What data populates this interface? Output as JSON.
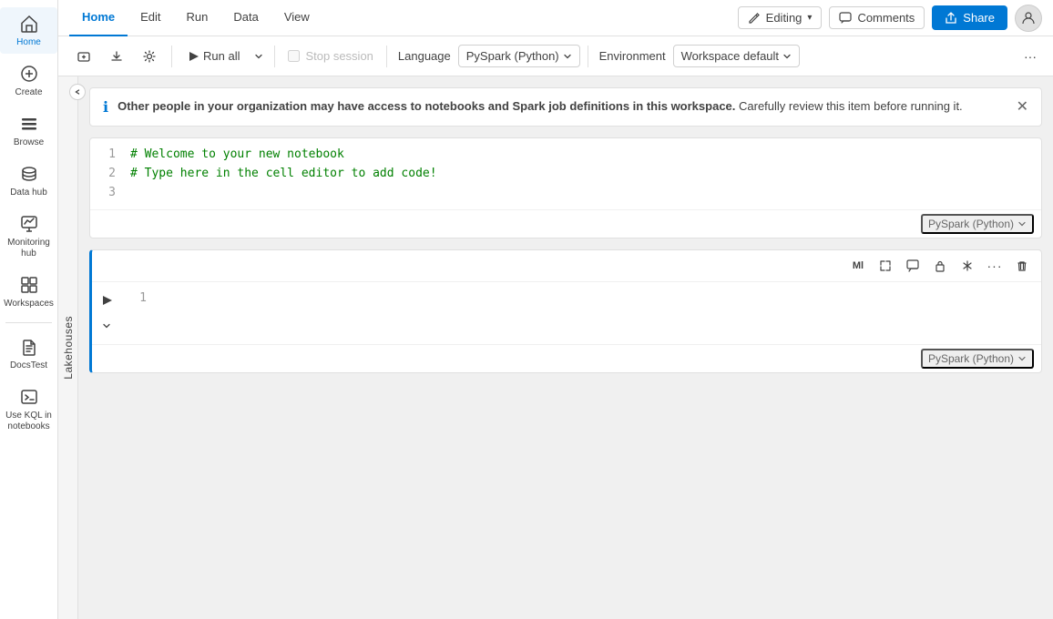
{
  "sidebar": {
    "items": [
      {
        "id": "home",
        "label": "Home",
        "icon": "⊞",
        "active": true
      },
      {
        "id": "create",
        "label": "Create",
        "icon": "+"
      },
      {
        "id": "browse",
        "label": "Browse",
        "icon": "☰"
      },
      {
        "id": "datahub",
        "label": "Data hub",
        "icon": "⊕"
      },
      {
        "id": "monitoring",
        "label": "Monitoring hub",
        "icon": "◎"
      },
      {
        "id": "workspaces",
        "label": "Workspaces",
        "icon": "⊞"
      },
      {
        "id": "docstest",
        "label": "DocsTest",
        "icon": "⚙"
      },
      {
        "id": "kql",
        "label": "Use KQL in notebooks",
        "icon": "≡"
      }
    ]
  },
  "topnav": {
    "tabs": [
      {
        "id": "home",
        "label": "Home",
        "active": true
      },
      {
        "id": "edit",
        "label": "Edit"
      },
      {
        "id": "run",
        "label": "Run"
      },
      {
        "id": "data",
        "label": "Data"
      },
      {
        "id": "view",
        "label": "View"
      }
    ],
    "editing_label": "Editing",
    "editing_chevron": "▾",
    "comments_label": "Comments",
    "share_label": "Share"
  },
  "toolbar": {
    "add_cell_label": "",
    "download_label": "",
    "settings_label": "",
    "run_all_label": "Run all",
    "run_all_chevron": "▾",
    "stop_session_label": "Stop session",
    "language_label": "Language",
    "pyspark_label": "PySpark (Python)",
    "pyspark_chevron": "▾",
    "environment_label": "Environment",
    "workspace_default_label": "Workspace default",
    "workspace_default_chevron": "▾",
    "more_label": "···"
  },
  "lakehouses": {
    "label": "Lakehouses"
  },
  "infobanner": {
    "bold_text": "Other people in your organization may have access to notebooks and Spark job definitions in this workspace.",
    "normal_text": " Carefully review this item before running it."
  },
  "cells": [
    {
      "id": "cell1",
      "lines": [
        {
          "num": 1,
          "text": "# Welcome to your new notebook",
          "type": "comment"
        },
        {
          "num": 2,
          "text": "# Type here in the cell editor to add code!",
          "type": "comment"
        },
        {
          "num": 3,
          "text": "",
          "type": "empty"
        }
      ],
      "lang": "PySpark (Python)",
      "active": false,
      "has_toolbar": false
    },
    {
      "id": "cell2",
      "lines": [
        {
          "num": 1,
          "text": "",
          "type": "empty"
        }
      ],
      "lang": "PySpark (Python)",
      "active": true,
      "has_toolbar": true
    }
  ],
  "cell_toolbar_icons": [
    {
      "id": "ml",
      "symbol": "Ml"
    },
    {
      "id": "expand",
      "symbol": "⤢"
    },
    {
      "id": "comment",
      "symbol": "💬"
    },
    {
      "id": "lock",
      "symbol": "🔒"
    },
    {
      "id": "asterisk",
      "symbol": "✳"
    },
    {
      "id": "more",
      "symbol": "···"
    },
    {
      "id": "delete",
      "symbol": "🗑"
    }
  ]
}
